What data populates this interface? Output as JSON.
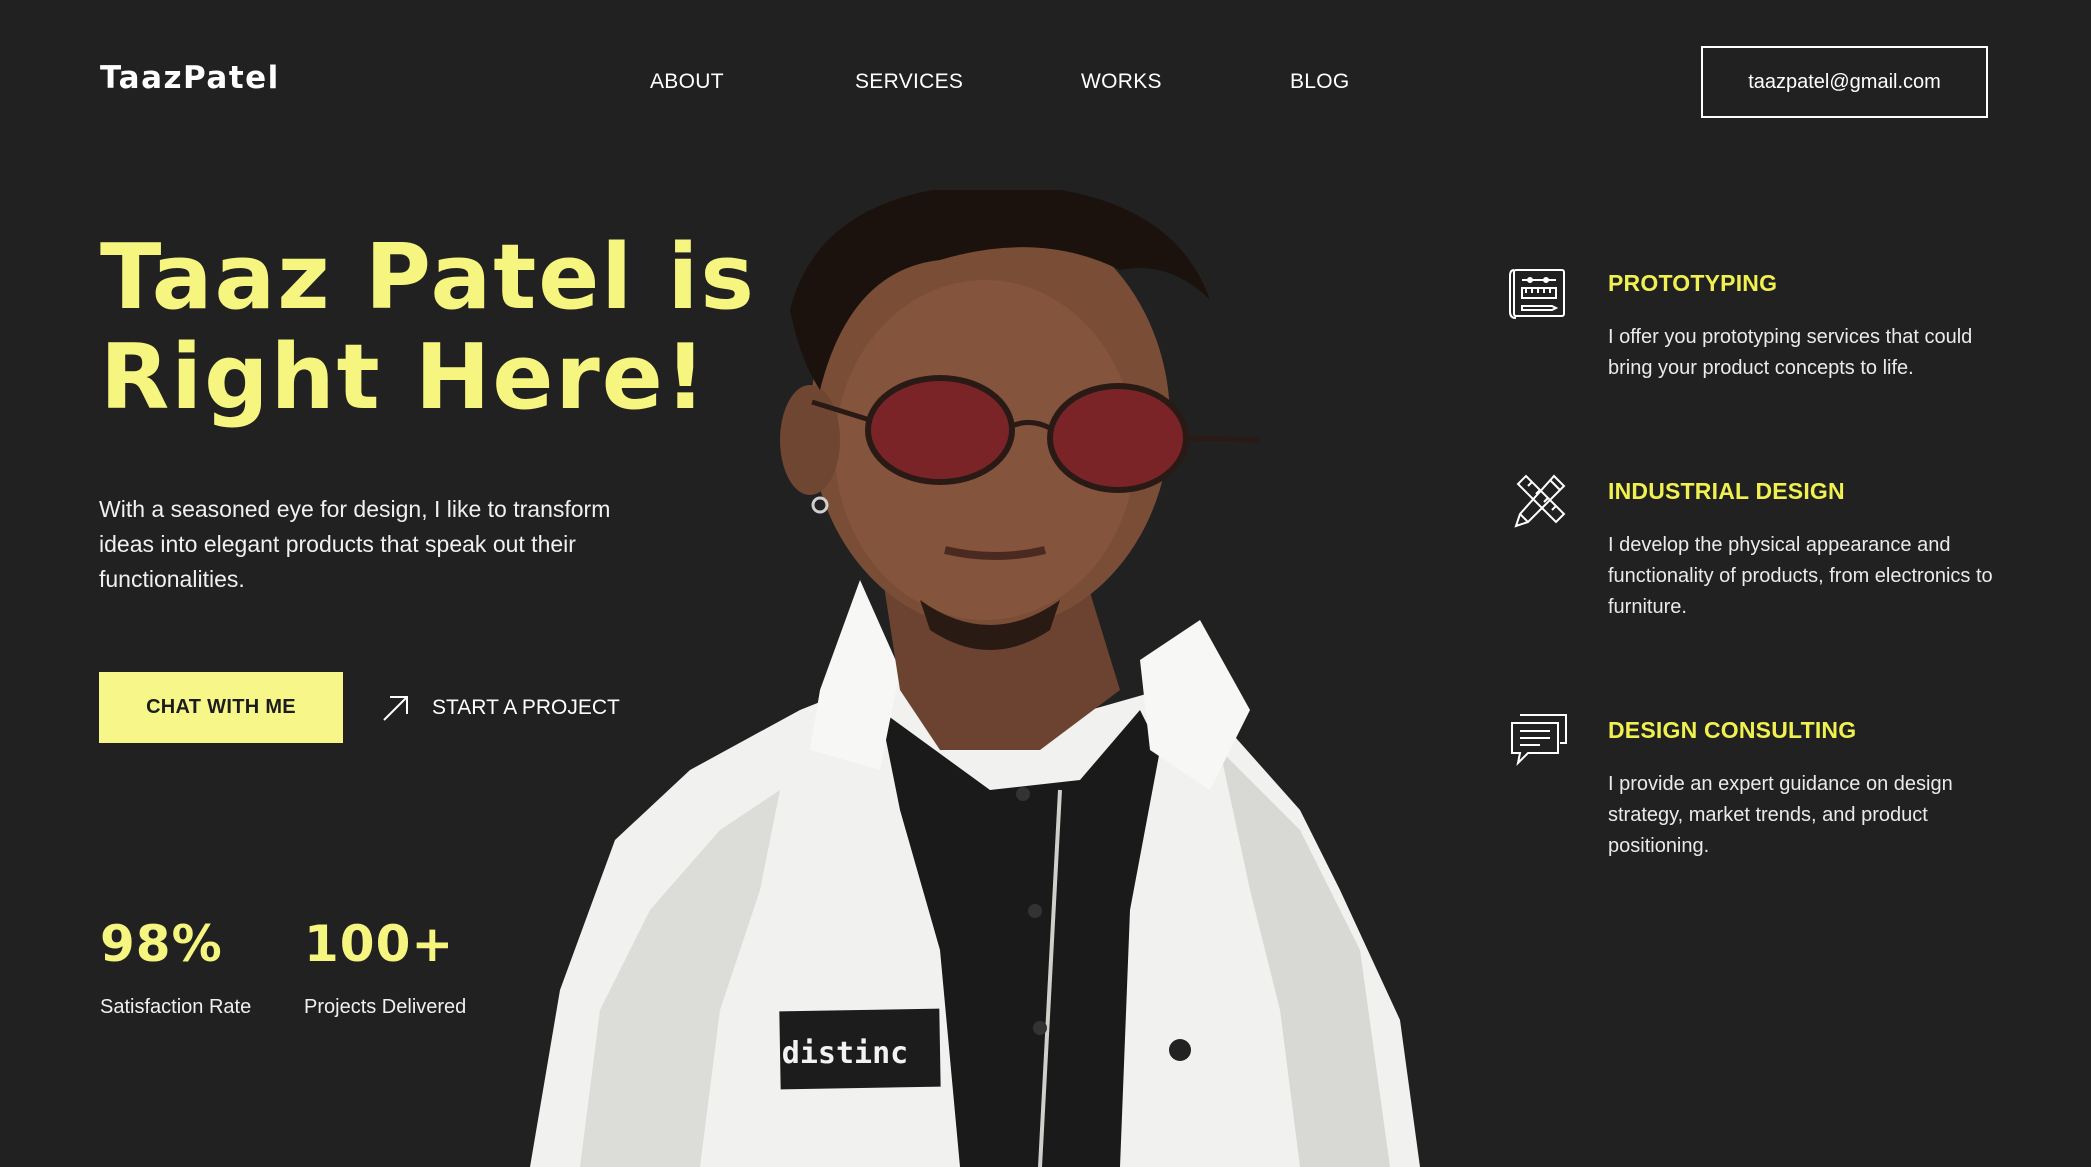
{
  "header": {
    "logo": "TaazPatel",
    "nav": [
      "ABOUT",
      "SERVICES",
      "WORKS",
      "BLOG"
    ],
    "email": "taazpatel@gmail.com"
  },
  "hero": {
    "headline": "Taaz Patel is Right Here!",
    "intro": "With a seasoned eye for design, I like to transform ideas into elegant products that speak out their functionalities.",
    "cta_primary": "CHAT WITH ME",
    "cta_secondary": "START A PROJECT",
    "jacket_patch_text": "distinc"
  },
  "stats": [
    {
      "value": "98%",
      "label": "Satisfaction Rate"
    },
    {
      "value": "100+",
      "label": "Projects Delivered"
    }
  ],
  "services": [
    {
      "icon": "blueprint-icon",
      "title": "PROTOTYPING",
      "description": "I offer you prototyping services that could bring your product concepts to life."
    },
    {
      "icon": "pencil-ruler-icon",
      "title": "INDUSTRIAL DESIGN",
      "description": "I develop the physical appearance and functionality of products, from electronics to furniture."
    },
    {
      "icon": "chat-bubbles-icon",
      "title": "DESIGN CONSULTING",
      "description": "I provide an expert guidance on design strategy, market trends, and product positioning."
    }
  ],
  "colors": {
    "background": "#212121",
    "accent": "#f5f57f",
    "button": "#f6f689",
    "service_title": "#f0f050"
  }
}
